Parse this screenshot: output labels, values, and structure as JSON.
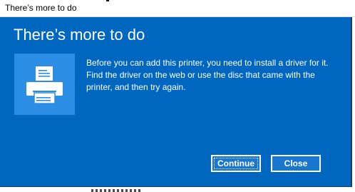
{
  "window": {
    "title": "There’s more to do"
  },
  "dialog": {
    "heading": "There’s more to do",
    "icon": "printer-icon",
    "message": "Before you can add this printer, you need to install a driver for it. Find the driver on the web or use the disc that came with the printer, and then try again.",
    "buttons": {
      "continue_label": "Continue",
      "close_label": "Close"
    }
  },
  "colors": {
    "dialog_background": "#0067c0",
    "icon_tile": "#2b8de3",
    "text": "#ffffff"
  }
}
